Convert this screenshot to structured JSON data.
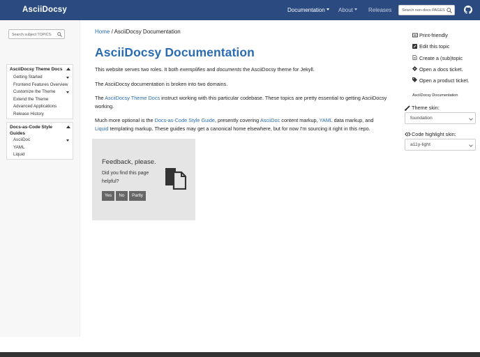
{
  "navbar": {
    "brand": "AsciiDocsy",
    "items": [
      {
        "label": "Documentation",
        "dropdown": true
      },
      {
        "label": "About",
        "dropdown": true
      },
      {
        "label": "Releases",
        "dropdown": false
      }
    ],
    "search_placeholder": "Search non-docs PAGES",
    "github_icon": "github-icon",
    "background_color": "#2b4a80"
  },
  "sidebar": {
    "search_placeholder": "Search subject TOPICS.",
    "sections": [
      {
        "title": "AsciiDocsy Theme Docs",
        "items": [
          {
            "label": "Getting Started",
            "expandable": true
          },
          {
            "label": "Frontend Features Overview",
            "expandable": false
          },
          {
            "label": "Customize the Theme",
            "expandable": true
          },
          {
            "label": "Extend the Theme",
            "expandable": false
          },
          {
            "label": "Advanced Applications",
            "expandable": false
          },
          {
            "label": "Release History",
            "expandable": false
          }
        ]
      },
      {
        "title": "Docs-as-Code Style Guides",
        "items": [
          {
            "label": "AsciiDoc",
            "expandable": true
          },
          {
            "label": "YAML",
            "expandable": false
          },
          {
            "label": "Liquid",
            "expandable": false
          }
        ]
      }
    ]
  },
  "main": {
    "breadcrumb": {
      "home": "Home",
      "separator": "/",
      "current": "AsciiDocsy Documentation"
    },
    "title": "AsciiDocsy Documentation",
    "p1": {
      "a": "This website serves two roles. It both ",
      "b": "exemplifies",
      "c": " and ",
      "d": "documents",
      "e": " the AsciiDocsy theme for Jekyll."
    },
    "p2": "The AsciiDocsy documentation is broken into two domains.",
    "p3": {
      "a": "The ",
      "link": "AsciiDocsy Theme Docs",
      "b": " instruct working with this particular codebase. These topics are pretty essential to getting AsciiDocsy working."
    },
    "p4": {
      "a": "Much more optional is the ",
      "link1": "Docs-as-Code Style Guide",
      "b": ", presently covering ",
      "link2": "AsciiDoc",
      "c": " content markup, ",
      "link3": "YAML",
      "d": " data markup, and ",
      "link4": "Liquid",
      "e": " templating markup. These guides may get a canonical home elsewhere, but for now I'm sourcing it right in this repo."
    },
    "link_color": "#2b6cb0"
  },
  "feedback": {
    "title": "Feedback, please.",
    "question": "Did you find this page helpful?",
    "buttons": [
      "Yes",
      "No",
      "Partly"
    ],
    "icon": "document-copy-icon"
  },
  "right_sidebar": {
    "actions": [
      {
        "label": "Print-friendly",
        "icon": "print-icon"
      },
      {
        "label": "Edit this topic",
        "icon": "edit-icon"
      },
      {
        "label": "Create a (sub)topic",
        "icon": "new-file-icon"
      },
      {
        "label": "Open a docs ticket.",
        "icon": "ticket-icon"
      },
      {
        "label": "Open a product ticket.",
        "icon": "tag-icon"
      }
    ],
    "heading": "AsciiDocsy Documentation",
    "theme_skin_label": "Theme skin:",
    "theme_skin_value": "foundation",
    "code_skin_label": "Code highlight skin:",
    "code_skin_value": "a11y-light"
  }
}
